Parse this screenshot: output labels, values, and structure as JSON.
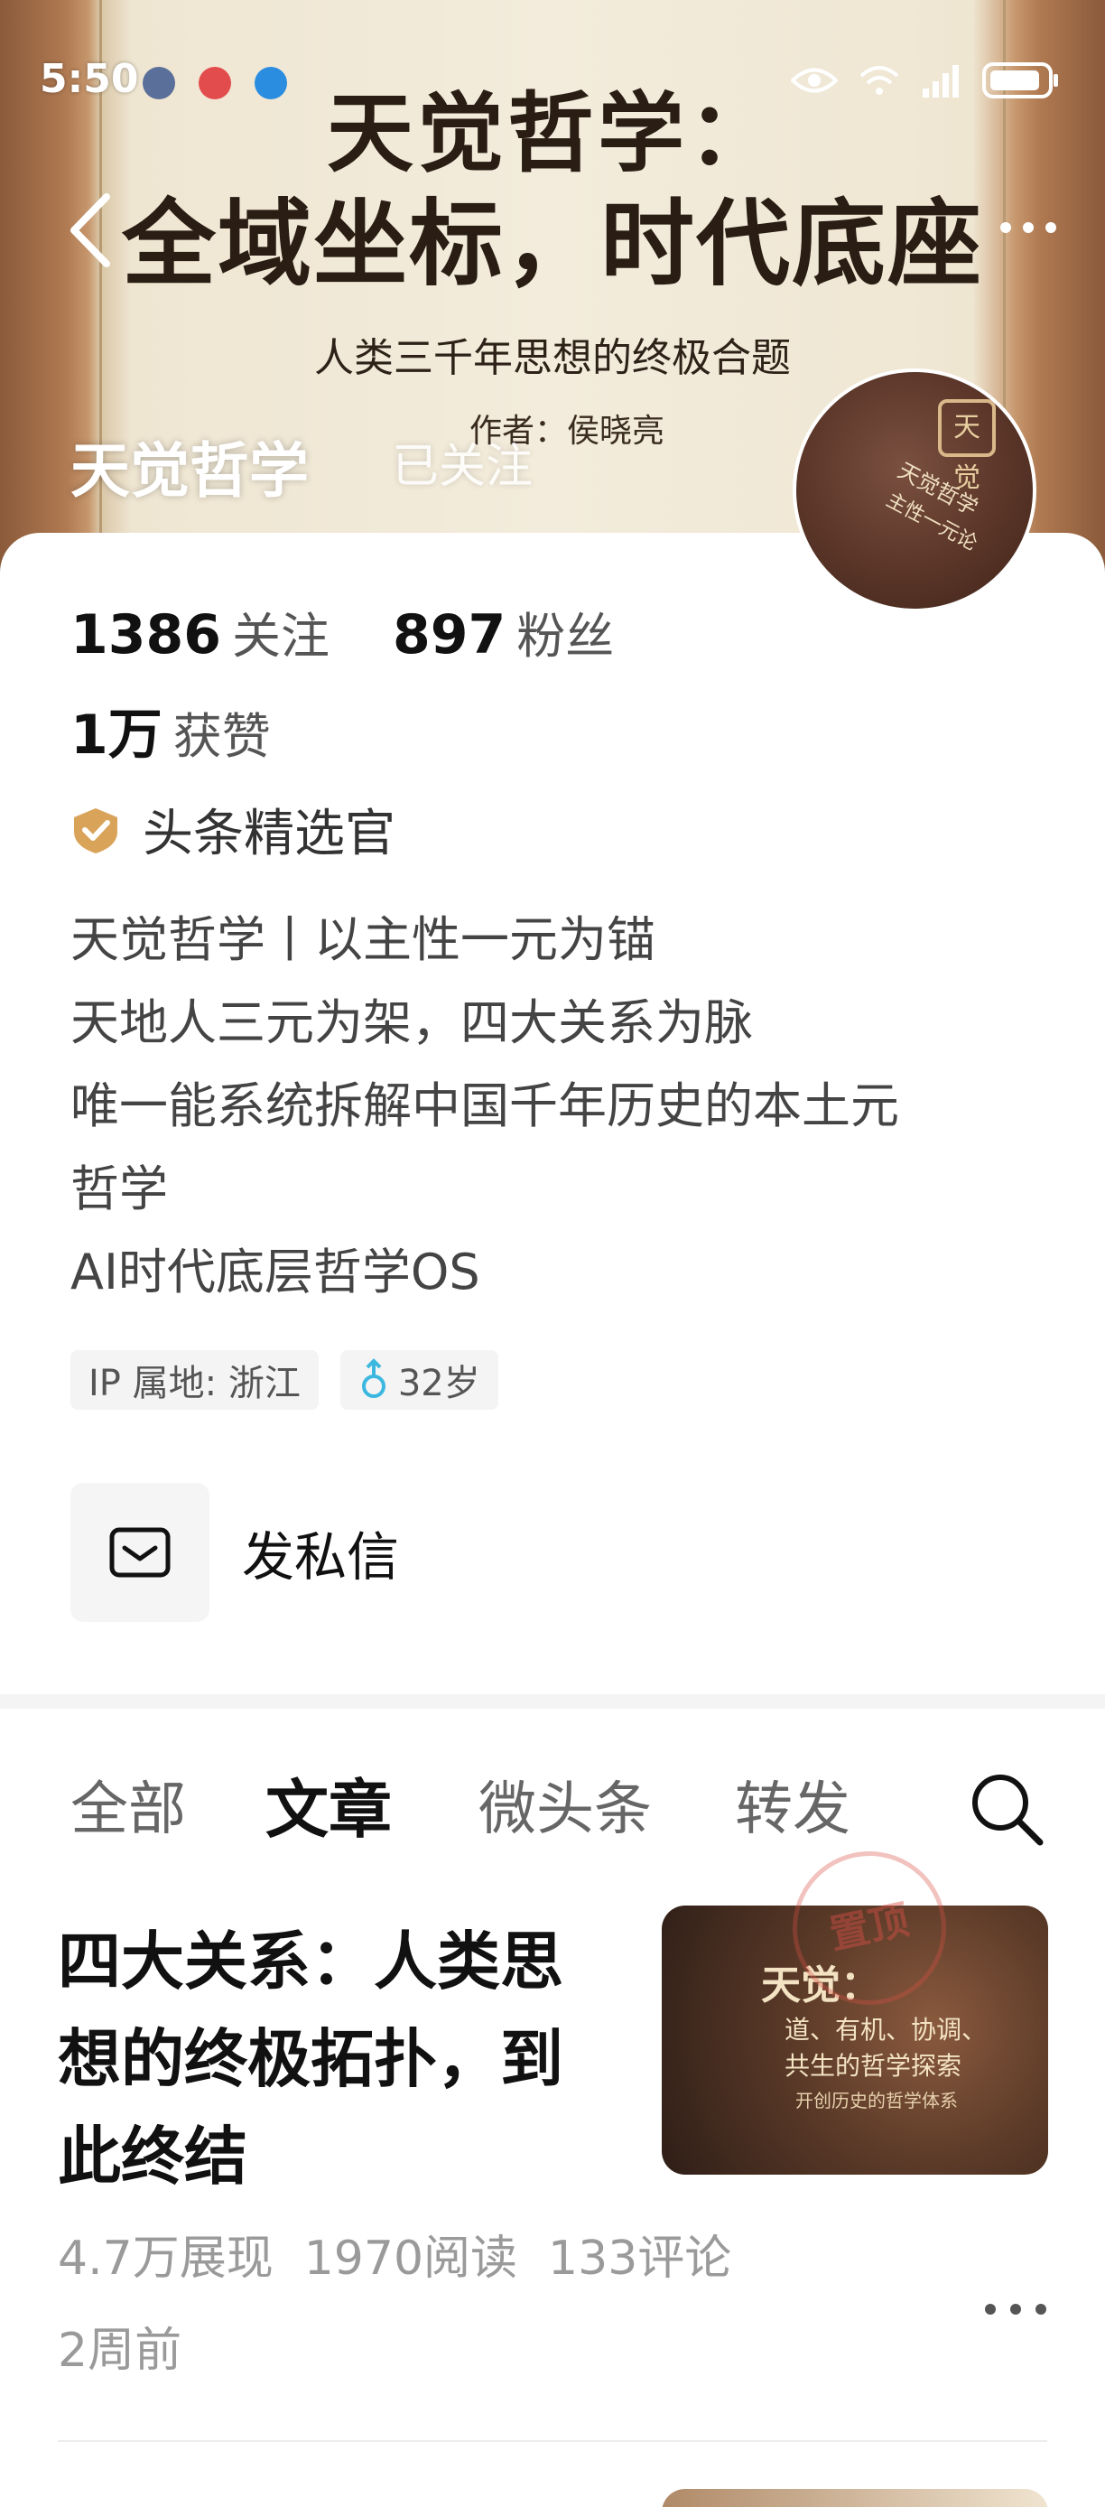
{
  "status_bar": {
    "time": "5:50"
  },
  "banner": {
    "line1": "天觉哲学：",
    "line2": "全域坐标，时代底座",
    "subtitle": "人类三千年思想的终极合题",
    "author": "作者：侯晓亮"
  },
  "header": {
    "title": "天觉哲学",
    "follow_state": "已关注",
    "back_icon": "chevron-left-icon",
    "more_icon": "more-dots-icon"
  },
  "avatar": {
    "badge": "天觉",
    "text1": "天觉哲学",
    "text2": "主性一元论"
  },
  "profile": {
    "following_count": "1386",
    "following_label": "关注",
    "followers_count": "897",
    "followers_label": "粉丝",
    "likes_count": "1万",
    "likes_label": "获赞",
    "verified_label": "头条精选官",
    "bio_lines": [
      "天觉哲学丨以主性一元为锚",
      "天地人三元为架，四大关系为脉",
      "唯一能系统拆解中国千年历史的本土元",
      "哲学",
      "AI时代底层哲学OS"
    ],
    "ip_location": "IP 属地: 浙江",
    "age": "32岁",
    "dm_label": "发私信"
  },
  "tabs": [
    {
      "label": "全部",
      "active": false
    },
    {
      "label": "文章",
      "active": true
    },
    {
      "label": "微头条",
      "active": false
    },
    {
      "label": "转发",
      "active": false
    }
  ],
  "article": {
    "title": "四大关系：人类思想的终极拓扑，到此终结",
    "thumb_title": "天觉：",
    "thumb_sub1": "道、有机、协调、",
    "thumb_sub2": "共生的哲学探索",
    "thumb_sub3": "开创历史的哲学体系",
    "stamp": "置顶",
    "impressions": "4.7万展现",
    "reads": "1970阅读",
    "comments": "133评论",
    "time": "2周前"
  },
  "colors": {
    "accent_gold": "#d9a45a",
    "male_blue": "#3cb8e0",
    "text_primary": "#111111",
    "text_secondary": "#9a9a9a"
  }
}
